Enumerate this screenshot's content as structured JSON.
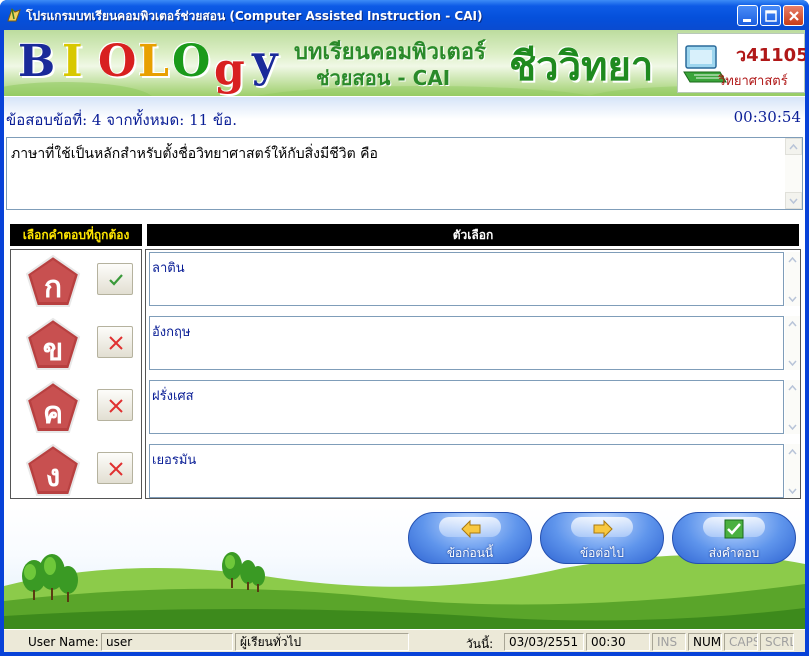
{
  "window": {
    "title": "โปรแกรมบทเรียนคอมพิวเตอร์ช่วยสอน (Computer Assisted Instruction - CAI)"
  },
  "banner": {
    "logo_letters": [
      "B",
      "I",
      "O",
      "L",
      "O",
      "g",
      "y"
    ],
    "logo_colors": [
      "#1a2a9a",
      "#d8c800",
      "#d82020",
      "#e8a000",
      "#1a9a1a",
      "#d82020",
      "#1a2a9a"
    ],
    "subtitle_line1": "บทเรียนคอมพิวเตอร์",
    "subtitle_line2": "ช่วยสอน - CAI",
    "title": "ชีววิทยา",
    "course_code": "ว41105",
    "course_subject": "วิทยาศาสตร์"
  },
  "info": {
    "question_progress": "ข้อสอบข้อที่: 4 จากทั้งหมด: 11 ข้อ.",
    "timer": "00:30:54"
  },
  "question": {
    "text": "ภาษาที่ใช้เป็นหลักสำหรับตั้งชื่อวิทยาศาสตร์ให้กับสิ่งมีชีวิต คือ"
  },
  "answers": {
    "choose_header": "เลือกคำตอบที่ถูกต้อง",
    "options_header": "ตัวเลือก",
    "items": [
      {
        "letter": "ก",
        "text": "ลาติน",
        "state": "check"
      },
      {
        "letter": "ข",
        "text": "อังกฤษ",
        "state": "cross"
      },
      {
        "letter": "ค",
        "text": "ฝรั่งเศส",
        "state": "cross"
      },
      {
        "letter": "ง",
        "text": "เยอรมัน",
        "state": "cross"
      }
    ]
  },
  "nav": {
    "prev_label": "ข้อก่อนนี้",
    "next_label": "ข้อต่อไป",
    "submit_label": "ส่งคำตอบ"
  },
  "status": {
    "user_label": "User Name:",
    "user_value": "user",
    "role_value": "ผู้เรียนทั่วไป",
    "date_label": "วันนี้:",
    "date_value": "03/03/2551",
    "time_value": "00:30",
    "ins": "INS",
    "num": "NUM",
    "caps": "CAPS",
    "scrl": "SCRL"
  }
}
